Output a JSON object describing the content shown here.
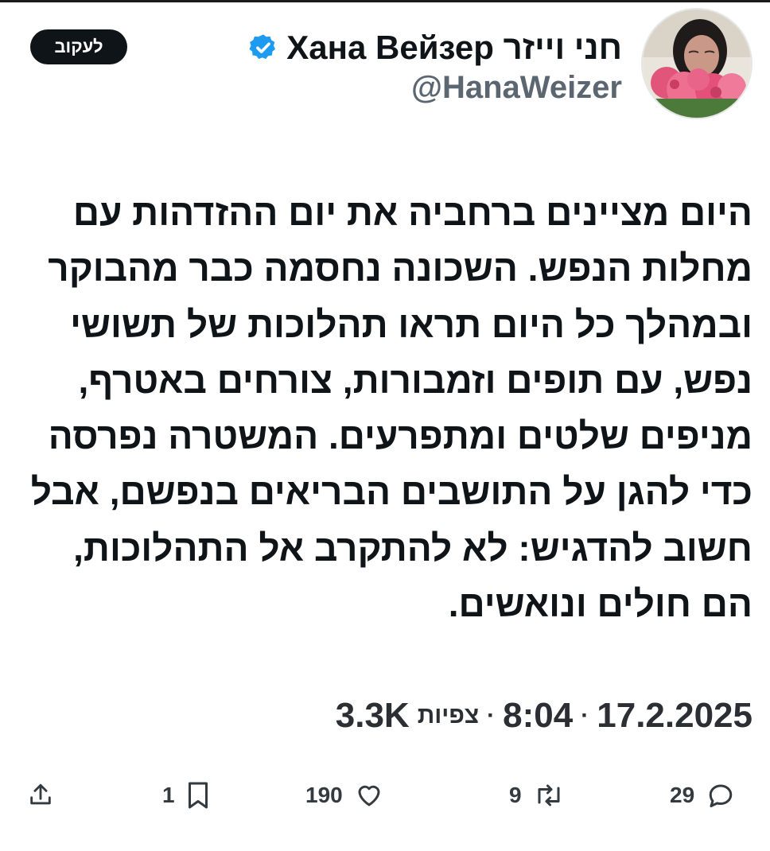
{
  "profile": {
    "display_name": "Хана Вейзер חני וייזר",
    "handle": "@HanaWeizer",
    "avatar_icon": "profile-photo-woman-with-pink-roses",
    "verified_icon": "verified-badge-icon"
  },
  "follow_button": {
    "label": "לעקוב"
  },
  "tweet": {
    "text": "היום מציינים ברחביה את יום ההזדהות עם מחלות הנפש. השכונה נחסמה כבר מהבוקר ובמהלך כל היום תראו תהלוכות של תשושי נפש, עם תופים וזמבורות, צורחים באטרף, מניפים שלטים ומתפרעים. המשטרה נפרסה כדי להגן על התושבים הבריאים בנפשם, אבל חשוב להדגיש: לא להתקרב אל התהלוכות, הם חולים ונואשים."
  },
  "meta": {
    "date": "17.2.2025",
    "time": "8:04",
    "separator": "·",
    "views_label": "צפיות",
    "views_count": "3.3K"
  },
  "actions": {
    "replies": {
      "count": "29",
      "icon": "reply-icon"
    },
    "reposts": {
      "count": "9",
      "icon": "repost-icon"
    },
    "likes": {
      "count": "190",
      "icon": "heart-icon"
    },
    "bookmarks": {
      "count": "1",
      "icon": "bookmark-icon"
    },
    "share": {
      "icon": "share-icon"
    }
  },
  "colors": {
    "verified_blue": "#1d9bf0",
    "text": "#0f1419",
    "secondary": "#5b6670",
    "follow_bg": "#0f1419"
  }
}
